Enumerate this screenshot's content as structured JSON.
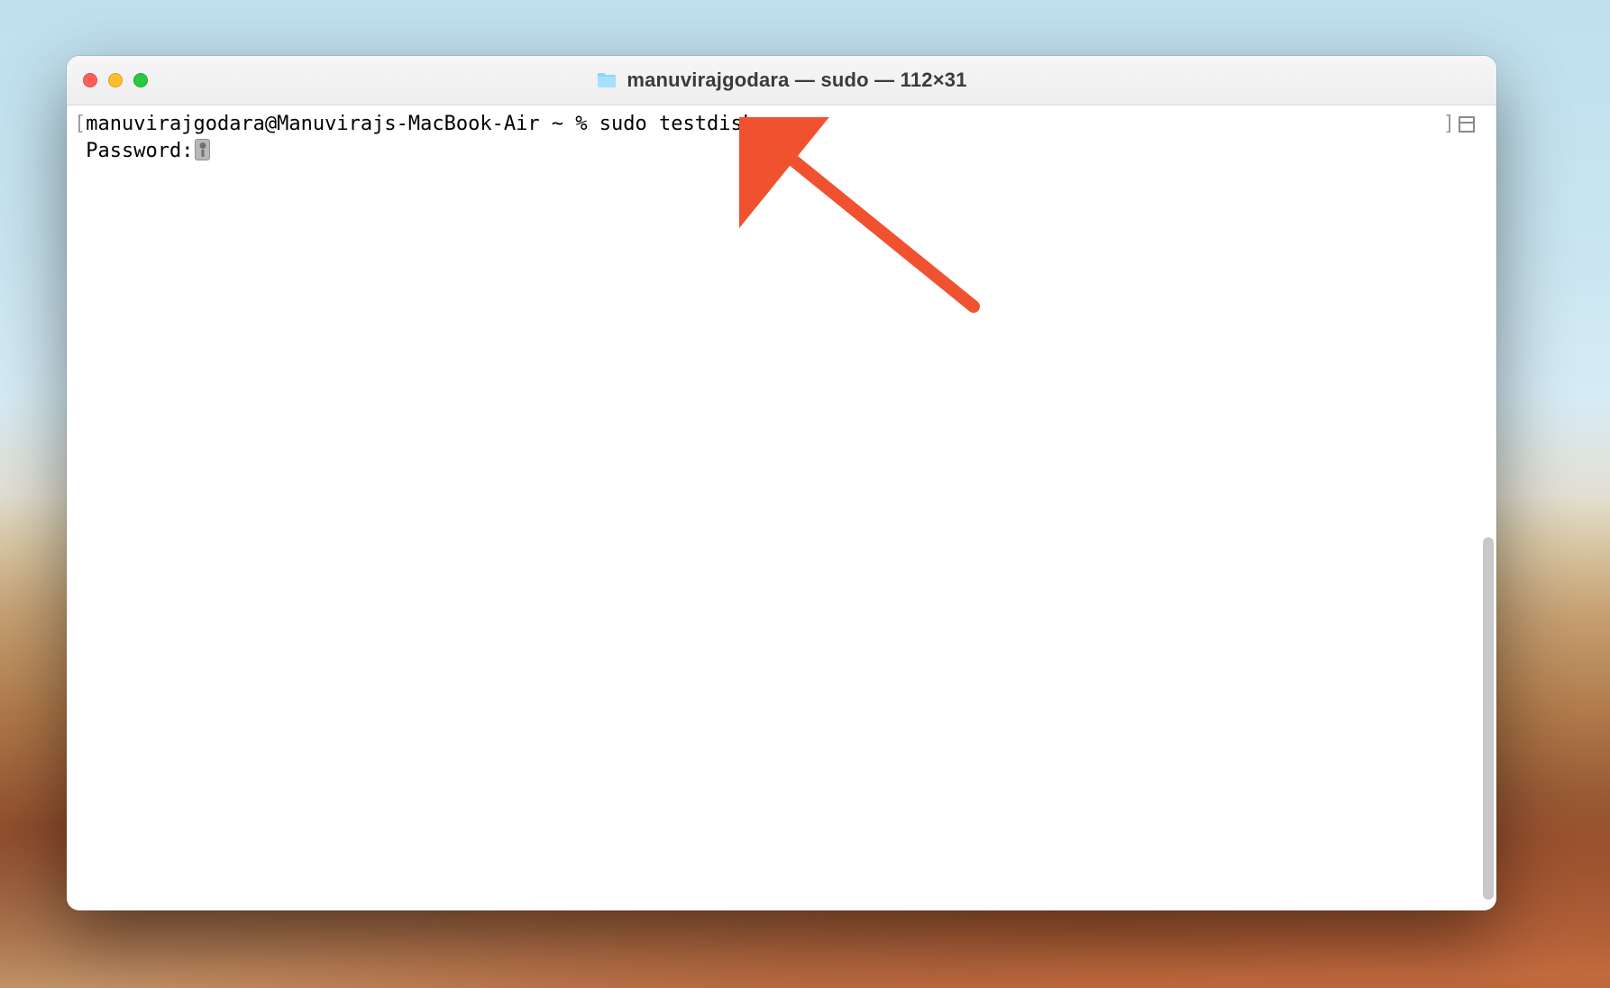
{
  "window": {
    "title": "manuvirajgodara — sudo — 112×31"
  },
  "terminal": {
    "prompt": "manuvirajgodara@Manuvirajs-MacBook-Air ~ % ",
    "command": "sudo testdisk",
    "password_label": "Password:"
  },
  "colors": {
    "arrow": "#f0522f"
  }
}
